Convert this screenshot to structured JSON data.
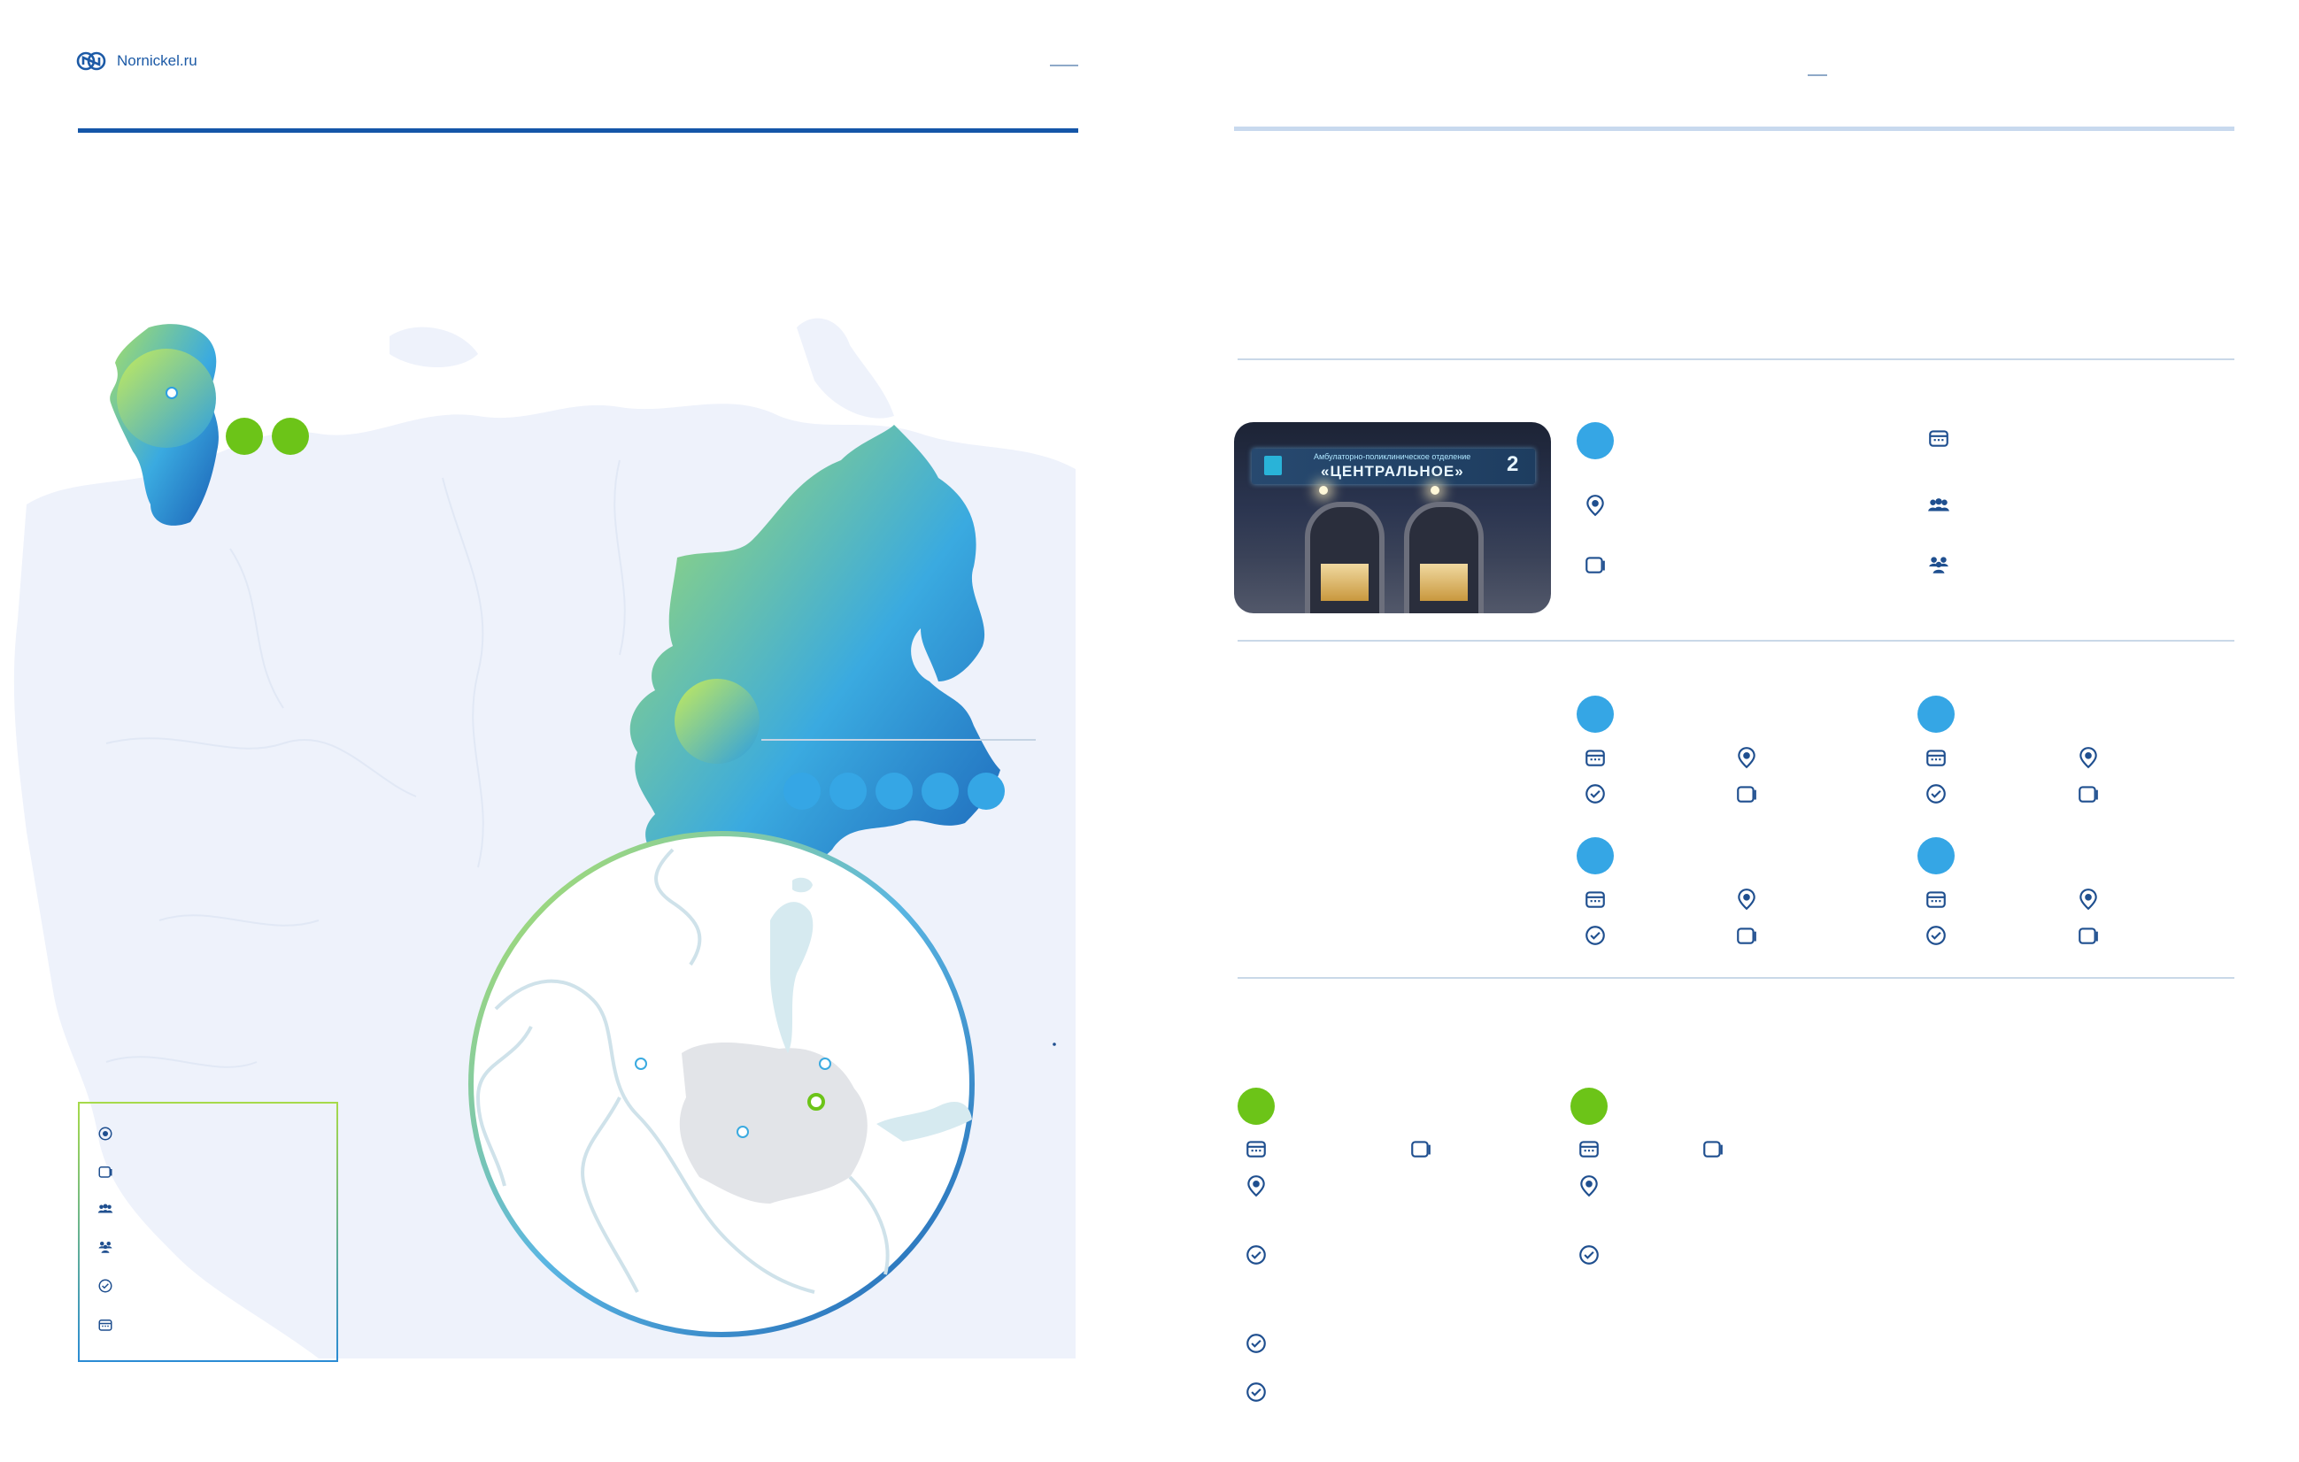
{
  "header": {
    "site": "Nornickel.ru"
  },
  "icons": {
    "pin": "map-pin-icon",
    "building": "building-icon",
    "people": "people-icon",
    "check": "check-circle-icon",
    "calendar": "calendar-icon",
    "logo": "nornickel-logo-icon"
  },
  "colors": {
    "brand_blue": "#1456a8",
    "accent_blue": "#35a6e5",
    "accent_green": "#6cc418",
    "rule_light": "#c8d9ee",
    "map_base": "#eef2fb"
  },
  "photo_sign": {
    "line1": "Амбулаторно-поликлиническое отделение",
    "line2": "«ЦЕНТРАЛЬНОЕ»",
    "number": "2"
  }
}
